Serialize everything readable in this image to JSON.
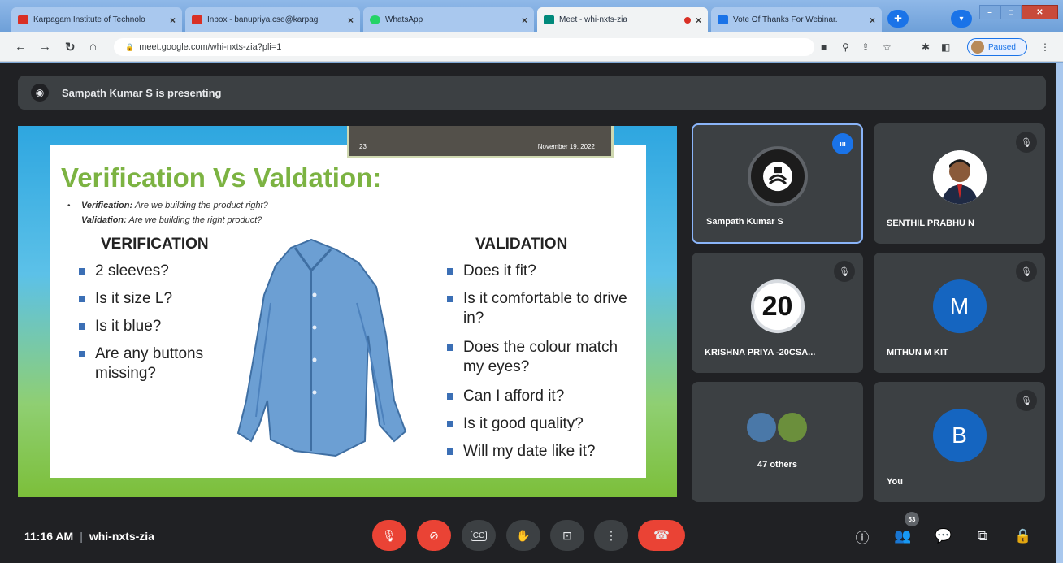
{
  "browser": {
    "tabs": [
      {
        "title": "Karpagam Institute of Technolo",
        "favicon_color": "#d93025"
      },
      {
        "title": "Inbox - banupriya.cse@karpag",
        "favicon_color": "#d93025"
      },
      {
        "title": "WhatsApp",
        "favicon_color": "#25d366"
      },
      {
        "title": "Meet - whi-nxts-zia",
        "favicon_color": "#00897b"
      },
      {
        "title": "Vote Of Thanks For Webinar.",
        "favicon_color": "#1a73e8"
      }
    ],
    "url": "meet.google.com/whi-nxts-zia?pli=1",
    "profile_status": "Paused"
  },
  "meet": {
    "presenter_text": "Sampath Kumar S is presenting",
    "meeting_time": "11:16 AM",
    "meeting_code": "whi-nxts-zia",
    "participant_count": "53"
  },
  "slide": {
    "page_number": "23",
    "date": "November 19, 2022",
    "title": "Verification Vs Valdation:",
    "def_verification_term": "Verification:",
    "def_verification_text": "Are we building the product right?",
    "def_validation_term": "Validation:",
    "def_validation_text": "Are we building the right product?",
    "verification_heading": "VERIFICATION",
    "validation_heading": "VALIDATION",
    "verification_items": [
      "2 sleeves?",
      "Is it size L?",
      "Is it blue?",
      "Are any buttons missing?"
    ],
    "validation_items": [
      "Does it fit?",
      "Is it comfortable to drive in?",
      "Does the colour match my eyes?",
      "Can I afford it?",
      "Is it good quality?",
      "Will my date like it?"
    ]
  },
  "participants": [
    {
      "name": "Sampath Kumar S",
      "state": "speaking"
    },
    {
      "name": "SENTHIL PRABHU N",
      "state": "muted"
    },
    {
      "name": "KRISHNA PRIYA -20CSA...",
      "avatar_text": "20",
      "state": "muted"
    },
    {
      "name": "MITHUN M KIT",
      "avatar_letter": "M",
      "state": "muted"
    },
    {
      "name": "47 others",
      "state": "group"
    },
    {
      "name": "You",
      "avatar_letter": "B",
      "state": "muted"
    }
  ],
  "colors": {
    "accent": "#1a73e8",
    "danger": "#ea4335",
    "slide_title": "#7cb342"
  }
}
